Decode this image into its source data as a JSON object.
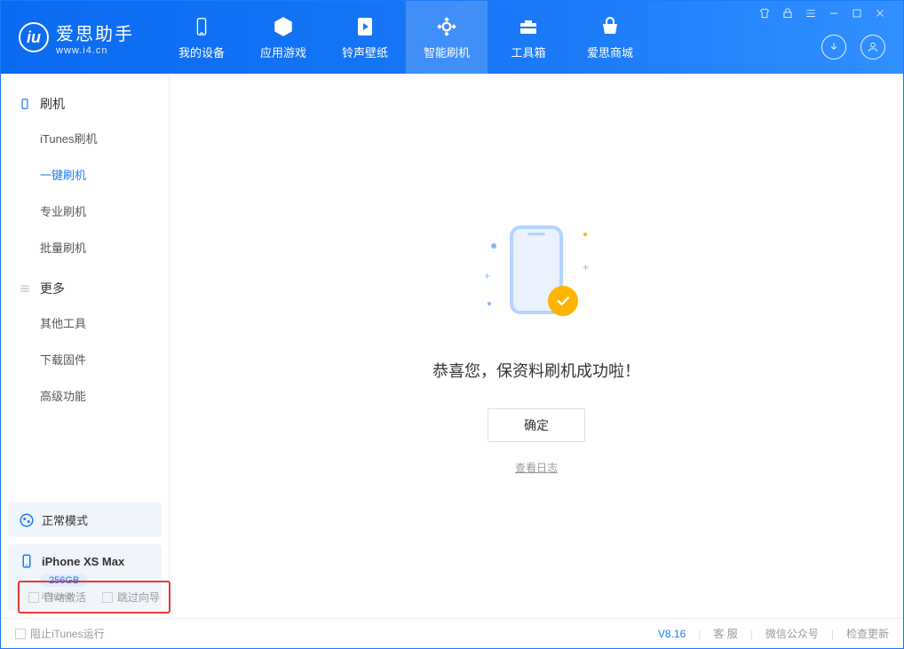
{
  "app": {
    "name": "爱思助手",
    "url": "www.i4.cn"
  },
  "nav": [
    {
      "id": "device",
      "label": "我的设备"
    },
    {
      "id": "apps",
      "label": "应用游戏"
    },
    {
      "id": "ringtones",
      "label": "铃声壁纸"
    },
    {
      "id": "flash",
      "label": "智能刷机",
      "active": true
    },
    {
      "id": "toolbox",
      "label": "工具箱"
    },
    {
      "id": "store",
      "label": "爱思商城"
    }
  ],
  "sidebar": {
    "groups": [
      {
        "title": "刷机",
        "icon": "phone",
        "items": [
          {
            "id": "itunes",
            "label": "iTunes刷机"
          },
          {
            "id": "oneclick",
            "label": "一键刷机",
            "active": true
          },
          {
            "id": "pro",
            "label": "专业刷机"
          },
          {
            "id": "batch",
            "label": "批量刷机"
          }
        ]
      },
      {
        "title": "更多",
        "icon": "menu",
        "items": [
          {
            "id": "other",
            "label": "其他工具"
          },
          {
            "id": "firmware",
            "label": "下载固件"
          },
          {
            "id": "advanced",
            "label": "高级功能"
          }
        ]
      }
    ],
    "status": {
      "label": "正常模式"
    },
    "device": {
      "name": "iPhone XS Max",
      "capacity": "256GB",
      "type": "iPhone"
    }
  },
  "main": {
    "success_title": "恭喜您，保资料刷机成功啦！",
    "ok_button": "确定",
    "log_link": "查看日志"
  },
  "options": {
    "auto_activate": "自动激活",
    "skip_guide": "跳过向导"
  },
  "footer": {
    "block_itunes": "阻止iTunes运行",
    "version": "V8.16",
    "support": "客 服",
    "wechat": "微信公众号",
    "update": "检查更新"
  }
}
